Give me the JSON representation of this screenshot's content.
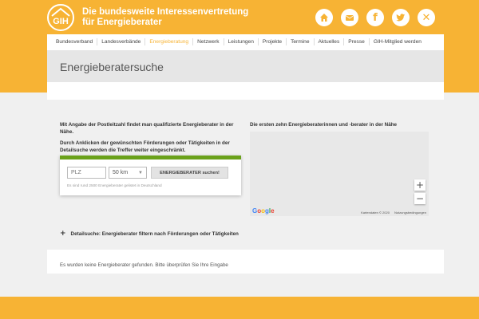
{
  "header": {
    "logo_text": "GIH",
    "tagline_line1": "Die bundesweite Interessenvertretung",
    "tagline_line2": "für Energieberater",
    "social": [
      "home-icon",
      "mail-icon",
      "facebook-icon",
      "twitter-icon",
      "xing-icon"
    ]
  },
  "nav": {
    "items": [
      {
        "label": "Bundesverband"
      },
      {
        "label": "Landesverbände"
      },
      {
        "label": "Energieberatung",
        "active": true
      },
      {
        "label": "Netzwerk"
      },
      {
        "label": "Leistungen"
      },
      {
        "label": "Projekte"
      },
      {
        "label": "Termine"
      },
      {
        "label": "Aktuelles"
      },
      {
        "label": "Presse"
      },
      {
        "label": "GIH-Mitglied werden"
      }
    ]
  },
  "page": {
    "title": "Energieberatersuche"
  },
  "intro": {
    "p1": "Mit Angabe der Postleitzahl findet man qualifizierte Energieberater in der Nähe.",
    "p2": "Durch Anklicken der gewünschten Förderungen oder Tätigkeiten in der Detailsuche werden die Treffer weiter eingeschränkt."
  },
  "search": {
    "plz_placeholder": "PLZ",
    "radius_value": "50 km",
    "button_label": "ENERGIEBERATER suchen!",
    "hint": "Es sind rund 2500 Energieberater gelistet in Deutschland"
  },
  "map": {
    "heading": "Die ersten zehn Energieberaterinnen und -berater in der Nähe",
    "zoom_in": "+",
    "zoom_out": "−",
    "attribution": "Kartendaten © 2020",
    "terms": "Nutzungsbedingungen",
    "google_letters": [
      "G",
      "o",
      "o",
      "g",
      "l",
      "e"
    ],
    "google_colors": [
      "#4285f4",
      "#ea4335",
      "#fbbc05",
      "#4285f4",
      "#34a853",
      "#ea4335"
    ]
  },
  "detail": {
    "toggle_symbol": "+",
    "label": "Detailsuche: Energieberater filtern nach Förderungen oder Tätigkeiten"
  },
  "results": {
    "message": "Es wurden keine Energieberater gefunden. Bitte überprüfen Sie Ihre Eingabe"
  },
  "colors": {
    "brand_orange": "#f7b334",
    "accent_green": "#6aa11a"
  }
}
